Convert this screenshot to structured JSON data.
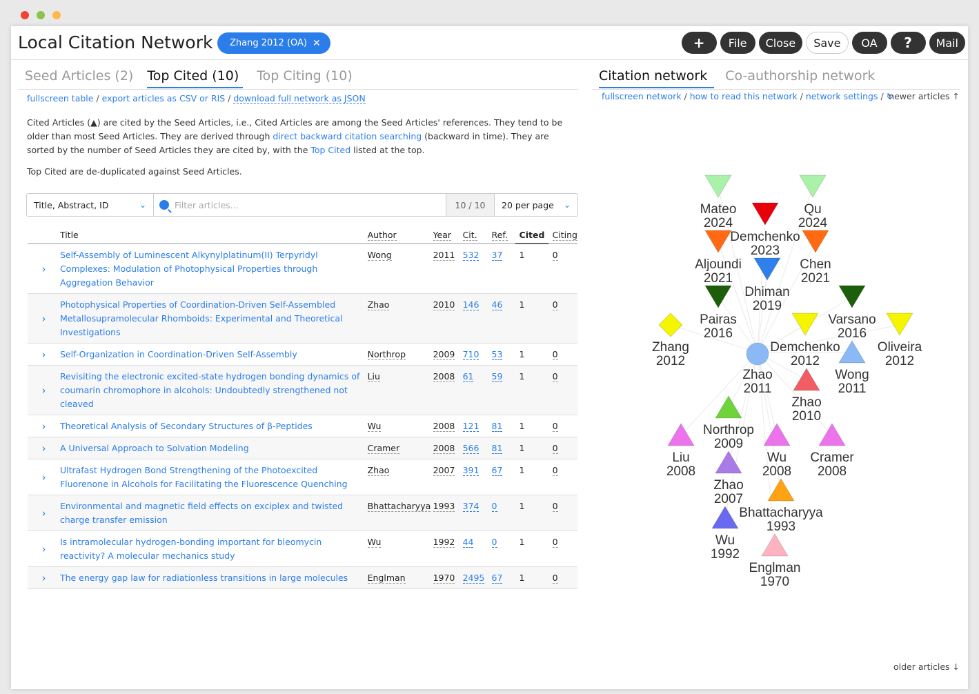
{
  "header": {
    "title": "Local Citation Network",
    "chip": "Zhang 2012 (OA)",
    "buttons": {
      "add": "+",
      "file": "File",
      "close": "Close",
      "save": "Save",
      "oa": "OA",
      "help": "?",
      "mail": "Mail"
    }
  },
  "tabs": [
    "Seed Articles (2)",
    "Top Cited (10)",
    "Top Citing (10)"
  ],
  "links": {
    "fullscreen": "fullscreen table",
    "export": "export articles as CSV or RIS",
    "download": "download full network as JSON"
  },
  "description": {
    "p1a": "Cited Articles (▲) are cited by the Seed Articles, i.e., Cited Articles are among the Seed Articles' references. They tend to be older than most Seed Articles. They are derived through ",
    "p1link": "direct backward citation searching",
    "p1b": " (backward in time). They are sorted by the number of Seed Articles they are cited by, with the ",
    "p1link2": "Top Cited",
    "p1c": " listed at the top.",
    "p2": "Top Cited are de-duplicated against Seed Articles."
  },
  "filter": {
    "field": "Title, Abstract, ID",
    "placeholder": "Filter articles...",
    "count": "10 / 10",
    "per_page": "20 per page"
  },
  "table": {
    "headers": {
      "title": "Title",
      "author": "Author",
      "year": "Year",
      "cit": "Cit.",
      "ref": "Ref.",
      "cited": "Cited",
      "citing": "Citing"
    },
    "rows": [
      {
        "title": "Self-Assembly of Luminescent Alkynylplatinum(II) Terpyridyl Complexes: Modulation of Photophysical Properties through Aggregation Behavior",
        "author": "Wong",
        "year": "2011",
        "cit": "532",
        "ref": "37",
        "cited": "1",
        "citing": "0"
      },
      {
        "title": "Photophysical Properties of Coordination-Driven Self-Assembled Metallosupramolecular Rhomboids: Experimental and Theoretical Investigations",
        "author": "Zhao",
        "year": "2010",
        "cit": "146",
        "ref": "46",
        "cited": "1",
        "citing": "0"
      },
      {
        "title": "Self-Organization in Coordination-Driven Self-Assembly",
        "author": "Northrop",
        "year": "2009",
        "cit": "710",
        "ref": "53",
        "cited": "1",
        "citing": "0"
      },
      {
        "title": "Revisiting the electronic excited-state hydrogen bonding dynamics of coumarin chromophore in alcohols: Undoubtedly strengthened not cleaved",
        "author": "Liu",
        "year": "2008",
        "cit": "61",
        "ref": "59",
        "cited": "1",
        "citing": "0"
      },
      {
        "title": "Theoretical Analysis of Secondary Structures of β-Peptides",
        "author": "Wu",
        "year": "2008",
        "cit": "121",
        "ref": "81",
        "cited": "1",
        "citing": "0"
      },
      {
        "title": "A Universal Approach to Solvation Modeling",
        "author": "Cramer",
        "year": "2008",
        "cit": "566",
        "ref": "81",
        "cited": "1",
        "citing": "0"
      },
      {
        "title": "Ultrafast Hydrogen Bond Strengthening of the Photoexcited Fluorenone in Alcohols for Facilitating the Fluorescence Quenching",
        "author": "Zhao",
        "year": "2007",
        "cit": "391",
        "ref": "67",
        "cited": "1",
        "citing": "0"
      },
      {
        "title": "Environmental and magnetic field effects on exciplex and twisted charge transfer emission",
        "author": "Bhattacharyya",
        "year": "1993",
        "cit": "374",
        "ref": "0",
        "cited": "1",
        "citing": "0"
      },
      {
        "title": "Is intramolecular hydrogen-bonding important for bleomycin reactivity? A molecular mechanics study",
        "author": "Wu",
        "year": "1992",
        "cit": "44",
        "ref": "0",
        "cited": "1",
        "citing": "0"
      },
      {
        "title": "The energy gap law for radiationless transitions in large molecules",
        "author": "Englman",
        "year": "1970",
        "cit": "2495",
        "ref": "67",
        "cited": "1",
        "citing": "0"
      }
    ]
  },
  "right": {
    "tabs": [
      "Citation network",
      "Co-authorship network"
    ],
    "links": {
      "fullscreen": "fullscreen network",
      "how": "how to read this network",
      "settings": "network settings",
      "refresh": "↻"
    },
    "newer": "newer articles ↑",
    "older": "older articles ↓"
  },
  "network": {
    "nodes": [
      {
        "name": "Mateo",
        "year": "2024",
        "shape": "tri-down",
        "color": "#aaf2aa"
      },
      {
        "name": "Qu",
        "year": "2024",
        "shape": "tri-down",
        "color": "#aaf2aa"
      },
      {
        "name": "Demchenko",
        "year": "2023",
        "shape": "tri-down",
        "color": "#e8000b"
      },
      {
        "name": "Aljoundi",
        "year": "2021",
        "shape": "tri-down",
        "color": "#ff6a13"
      },
      {
        "name": "Chen",
        "year": "2021",
        "shape": "tri-down",
        "color": "#ff6a13"
      },
      {
        "name": "Dhiman",
        "year": "2019",
        "shape": "tri-down",
        "color": "#2f80ed"
      },
      {
        "name": "Pairas",
        "year": "2016",
        "shape": "tri-down",
        "color": "#1c5e0a"
      },
      {
        "name": "Varsano",
        "year": "2016",
        "shape": "tri-down",
        "color": "#1c5e0a"
      },
      {
        "name": "Zhang",
        "year": "2012",
        "shape": "diamond",
        "color": "#f5f500"
      },
      {
        "name": "Demchenko",
        "year": "2012",
        "shape": "tri-down",
        "color": "#f5f500"
      },
      {
        "name": "Oliveira",
        "year": "2012",
        "shape": "tri-down",
        "color": "#f5f500"
      },
      {
        "name": "Zhao",
        "year": "2011",
        "shape": "circle",
        "color": "#8ab9f5"
      },
      {
        "name": "Wong",
        "year": "2011",
        "shape": "tri-up",
        "color": "#8ab9f5"
      },
      {
        "name": "Zhao",
        "year": "2010",
        "shape": "tri-up",
        "color": "#f25c63"
      },
      {
        "name": "Northrop",
        "year": "2009",
        "shape": "tri-up",
        "color": "#6fd43c"
      },
      {
        "name": "Liu",
        "year": "2008",
        "shape": "tri-up",
        "color": "#ec73ec"
      },
      {
        "name": "Wu",
        "year": "2008",
        "shape": "tri-up",
        "color": "#ec73ec"
      },
      {
        "name": "Cramer",
        "year": "2008",
        "shape": "tri-up",
        "color": "#ec73ec"
      },
      {
        "name": "Zhao",
        "year": "2007",
        "shape": "tri-up",
        "color": "#a97be6"
      },
      {
        "name": "Bhattacharyya",
        "year": "1993",
        "shape": "tri-up",
        "color": "#ffa313"
      },
      {
        "name": "Wu",
        "year": "1992",
        "shape": "tri-up",
        "color": "#6a6af0"
      },
      {
        "name": "Englman",
        "year": "1970",
        "shape": "tri-up",
        "color": "#ffb2c0"
      }
    ]
  },
  "colors": {
    "accent": "#2b7de9",
    "dark_button": "#333333",
    "dot_red": "#ff5f57",
    "dot_green": "#8bc34a",
    "dot_yellow": "#ffbd2e"
  }
}
